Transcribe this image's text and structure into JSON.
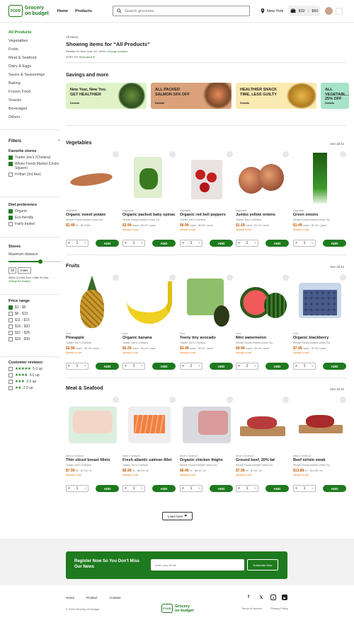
{
  "header": {
    "logo_tag": "FOOD",
    "logo_line1": "Grocery",
    "logo_line2": "on budget",
    "nav": [
      "Home",
      "Products"
    ],
    "search_placeholder": "Search groceries",
    "location": "New York",
    "cart_count": "$32",
    "cart_total": "$60"
  },
  "sidebar": {
    "categories": [
      "All Products",
      "Vegetables",
      "Fruits",
      "Meat & Seafood",
      "Dairy & Eggs",
      "Sauce & Seasonings",
      "Baking",
      "Frozen Food",
      "Snacks",
      "Beverages",
      "Others"
    ],
    "filters_title": "Filters",
    "fav_title": "Favorite stores",
    "stores": [
      {
        "label": "Trader Joe's (Chelsea)",
        "checked": true
      },
      {
        "label": "Whole Foods Market (Union Square)",
        "checked": true
      },
      {
        "label": "H-Mart (3rd Ave)",
        "checked": false
      }
    ],
    "diet_title": "Diet preference",
    "diets": [
      {
        "label": "Organic",
        "checked": true
      },
      {
        "label": "Eco friendly",
        "checked": true
      },
      {
        "label": "Fairly traded",
        "checked": false
      }
    ],
    "stores_title": "Stores",
    "max_dist": "Maximum distance",
    "miles_value": "10",
    "miles_unit": "miles",
    "dist_addr": "Within 10 miles from 1 Main St, New",
    "dist_change": "Change the location",
    "price_title": "Price range",
    "prices": [
      {
        "label": "$1 - $5",
        "checked": true
      },
      {
        "label": "$6 - $10",
        "checked": false
      },
      {
        "label": "$11 - $15",
        "checked": false
      },
      {
        "label": "$16 - $20",
        "checked": false
      },
      {
        "label": "$21 - $25",
        "checked": false
      },
      {
        "label": "$26 - $30",
        "checked": false
      }
    ],
    "reviews_title": "Customer reviews:",
    "reviews": [
      {
        "stars": "★★★★★",
        "label": "5.0 up"
      },
      {
        "stars": "★★★★",
        "label": "4.0 up"
      },
      {
        "stars": "★★★",
        "label": "3.0 up"
      },
      {
        "stars": "★★",
        "label": "2.0 up"
      }
    ]
  },
  "main": {
    "crumb": "All Items",
    "title": "Showing items for “All Products”",
    "location": "New York, NY 10001",
    "change": "Change location",
    "sort_label": "SORT BY",
    "sort_value": "Relevance",
    "savings_title": "Savings and more",
    "banners": [
      {
        "text": "New Year, New You. GET HEALTHIER",
        "cta": "Details",
        "bg": "#dff3c6"
      },
      {
        "text": "ALL PACKED SALMON 10% OFF",
        "cta": "Details",
        "bg": "#d9a27a"
      },
      {
        "text": "HEALTHIER SNACK TIME, LESS GUILTY",
        "cta": "Details",
        "bg": "#faeab0"
      },
      {
        "text": "ALL VEGETABL... 25% OFF",
        "cta": "Details",
        "bg": "#a7e3c9"
      }
    ],
    "add_label": "ADD",
    "load_more": "Load more"
  },
  "sections": [
    {
      "title": "Vegetables",
      "see_all": "See all 42",
      "products": [
        {
          "tag": "Vegetable",
          "name": "Organic sweet potato",
          "store": "Whole Foods Market Union Sq",
          "price": "$2.49",
          "unit": "/ lb · $2.49/lb",
          "note": "",
          "img": "potato"
        },
        {
          "tag": "Vegetable",
          "name": "Organic packed baby spinach",
          "store": "Whole Foods Market Union Sq",
          "price": "$2.99",
          "unit": "/ pack · $2.99 / pack",
          "note": "Already in cart",
          "img": "spinach"
        },
        {
          "tag": "Vegetable",
          "name": "Organic red bell peppers",
          "store": "Trader Joe's Chelsea",
          "price": "$6.99",
          "unit": "/ pack · $6.99 / pack",
          "note": "Already in cart",
          "img": "pepper"
        },
        {
          "tag": "Vegetable",
          "name": "Jumbo yellow onions",
          "store": "Trader Joe's Chelsea",
          "price": "$1.19",
          "unit": "/ each · $1.19 / each",
          "note": "Already in cart",
          "img": "onion"
        },
        {
          "tag": "Vegetable",
          "name": "Green onions",
          "store": "Whole Foods Market Union Sq",
          "price": "$1.49",
          "unit": "/ pack · $1.49 / pack",
          "note": "Already in cart",
          "img": "scallion"
        }
      ]
    },
    {
      "title": "Fruits",
      "see_all": "See all 42",
      "products": [
        {
          "tag": "Fruit",
          "name": "Pineapple",
          "store": "Trader Joe's Chelsea",
          "price": "$2.99",
          "unit": "/ each · $2.99 / each",
          "note": "Already in cart",
          "img": "pineapple"
        },
        {
          "tag": "Fruit",
          "name": "Organic banana",
          "store": "Trader Joe's Chelsea",
          "price": "$0.29",
          "unit": "/ each · $0.29 / each",
          "note": "Already in cart",
          "img": "banana"
        },
        {
          "tag": "Fruit",
          "name": "Teeny tiny avocado",
          "store": "Trader Joe's Chelsea",
          "price": "$3.49",
          "unit": "/ pack · $3.49 / pack",
          "note": "Already in cart",
          "img": "avocado"
        },
        {
          "tag": "Fruit",
          "name": "Mini watermelon",
          "store": "Whole Foods Market Union Sq",
          "price": "$4.99",
          "unit": "/ each · $4.99 / each",
          "note": "Already in cart",
          "img": "melon"
        },
        {
          "tag": "Fruit",
          "name": "Organic blackberry",
          "store": "Whole Foods Market Union Sq",
          "price": "$7.99",
          "unit": "/ pack · $7.99 / pack",
          "note": "Already in cart",
          "img": "berry"
        }
      ]
    },
    {
      "title": "Meat & Seafood",
      "see_all": "See all 42",
      "products": [
        {
          "tag": "Meat & Seafood",
          "name": "Thin sliced breast fillets",
          "store": "Trader Joe's Chelsea",
          "price": "$7.99",
          "unit": "/ lb · $7.99 / lb",
          "note": "Already in cart",
          "img": "chicken"
        },
        {
          "tag": "Meat & Seafood",
          "name": "Fresh atlantic salmon fillet",
          "store": "Trader Joe's Chelsea",
          "price": "$9.99",
          "unit": "/ lb · $9.99 / lb",
          "note": "Already in cart",
          "img": "salmon"
        },
        {
          "tag": "Meat & Seafood",
          "name": "Organic chicken thighs",
          "store": "Whole Foods Market Union Sq",
          "price": "$6.49",
          "unit": "/ lb · $6.49 / lb",
          "note": "Already in cart",
          "img": "thighs"
        },
        {
          "tag": "Meat & Seafood",
          "name": "Ground beef, 20% fat",
          "store": "Whole Foods Market Union Sq",
          "price": "$7.99",
          "unit": "/ lb · $7.99 / lb",
          "note": "Already in cart",
          "img": "beef"
        },
        {
          "tag": "Meat & Seafood",
          "name": "Beef sirloin steak",
          "store": "Whole Foods Market Union Sq",
          "price": "$13.89",
          "unit": "/ lb · $13.89 / lb",
          "note": "Already in cart",
          "img": "steak"
        }
      ]
    }
  ],
  "newsletter": {
    "title": "Register Now So You Don't Miss Our News",
    "placeholder": "Enter your Email",
    "button": "Subscribe Now"
  },
  "footer": {
    "links": [
      "Home",
      "Product",
      "Contact"
    ],
    "copyright": "© 2024 Grocery on budget",
    "terms": "Terms of service",
    "privacy": "Privacy Policy"
  }
}
